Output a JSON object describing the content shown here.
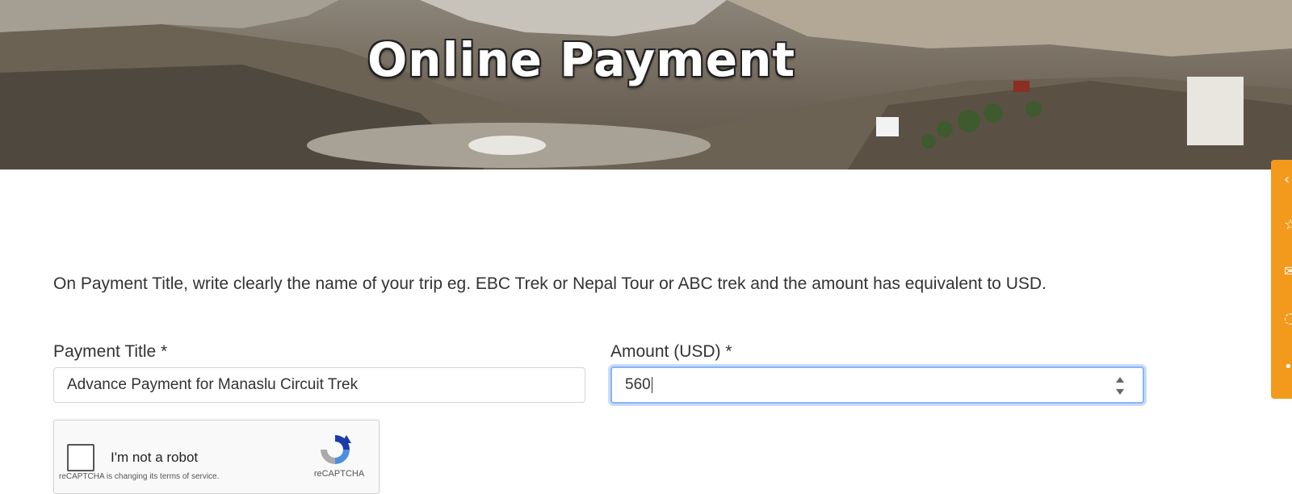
{
  "hero": {
    "title": "Online Payment"
  },
  "intro": {
    "text": "On Payment Title, write clearly the name of your trip eg. EBC Trek or Nepal Tour or ABC trek and  the amount has equivalent to USD."
  },
  "form": {
    "payment_title_label": "Payment Title  *",
    "payment_title_value": "Advance Payment for Manaslu Circuit Trek",
    "amount_label": "Amount (USD) *",
    "amount_value": "560"
  },
  "captcha": {
    "checkbox_label": "I'm not a robot",
    "terms_text": "reCAPTCHA is changing its terms of service.",
    "brand": "reCAPTCHA"
  },
  "side_bar": {
    "icons": [
      "share-icon",
      "star-icon",
      "mail-icon",
      "whatsapp-icon",
      "more-icon"
    ]
  },
  "colors": {
    "accent": "#f39a1d",
    "focus_ring": "#8ab4f8",
    "text": "#333333"
  }
}
